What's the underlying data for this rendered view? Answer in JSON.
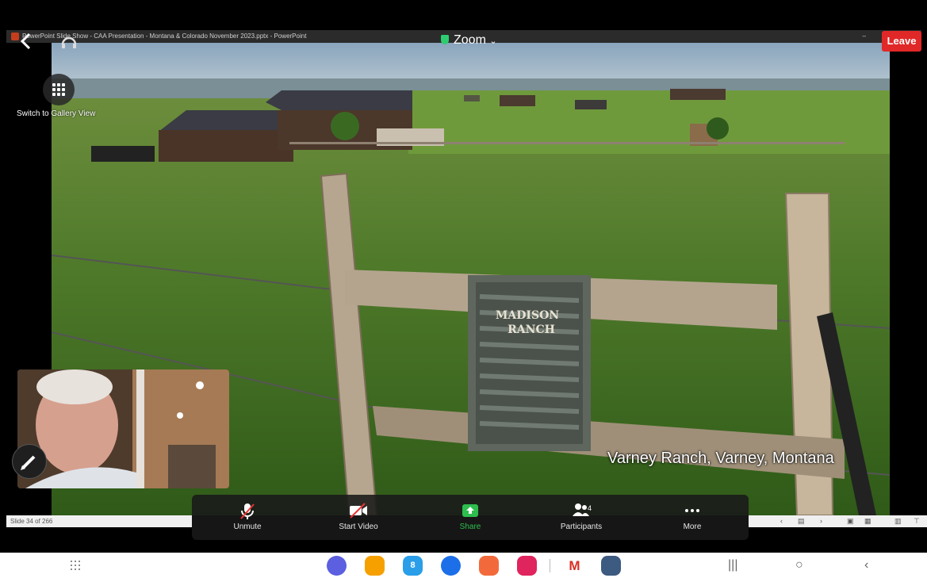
{
  "ppt": {
    "title": "PowerPoint Slide Show  -  CAA Presentation - Montana & Colorado November 2023.pptx - PowerPoint",
    "minimize": "–",
    "status": "Slide 34 of 266"
  },
  "zoom": {
    "title": "Zoom",
    "leave_label": "Leave",
    "gallery_label": "Switch to Gallery View"
  },
  "slide": {
    "sign_line1": "MADISON",
    "sign_line2": "RANCH",
    "caption": "Varney Ranch, Varney, Montana"
  },
  "toolbar": {
    "items": [
      {
        "label": "Unmute",
        "icon": "microphone-muted-icon"
      },
      {
        "label": "Start Video",
        "icon": "video-off-icon"
      },
      {
        "label": "Share",
        "icon": "share-screen-icon"
      },
      {
        "label": "Participants",
        "icon": "participants-icon",
        "count": "4"
      },
      {
        "label": "More",
        "icon": "more-icon"
      }
    ]
  },
  "dock": {
    "items": [
      {
        "name": "samsung-internet-icon",
        "color": "#5b5fe0"
      },
      {
        "name": "files-icon",
        "color": "#f6a000"
      },
      {
        "name": "calendar-icon",
        "color": "#2a9ee8",
        "text": "8"
      },
      {
        "name": "messages-icon",
        "color": "#1c6fe8"
      },
      {
        "name": "contacts-icon",
        "color": "#f26a3c"
      },
      {
        "name": "screen-recorder-icon",
        "color": "#e0245e"
      },
      {
        "name": "gmail-icon",
        "color": "#ffffff",
        "text": "M"
      },
      {
        "name": "settings-icon",
        "color": "#3d5a80"
      }
    ]
  },
  "colors": {
    "leave": "#e02828",
    "share": "#2dbe4e",
    "toolbar": "#191919"
  }
}
